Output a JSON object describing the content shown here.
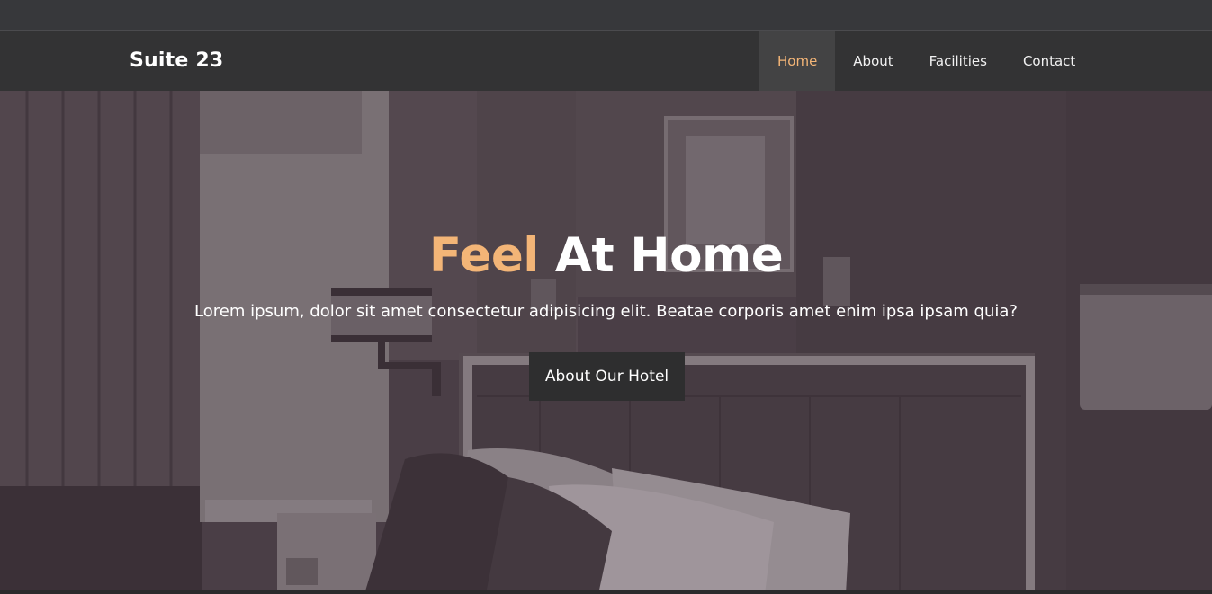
{
  "brand": {
    "name": "Suite 23"
  },
  "nav": {
    "items": [
      {
        "label": "Home",
        "active": true
      },
      {
        "label": "About",
        "active": false
      },
      {
        "label": "Facilities",
        "active": false
      },
      {
        "label": "Contact",
        "active": false
      }
    ]
  },
  "hero": {
    "headline_accent": "Feel",
    "headline_rest": "At Home",
    "subtext": "Lorem ipsum, dolor sit amet consectetur adipisicing elit. Beatae corporis amet enim ipsa ipsam quia?",
    "cta_label": "About Our Hotel"
  },
  "colors": {
    "accent": "#f3b577",
    "navbar": "#333334",
    "button": "#2e2e2f",
    "hero_tint": "#4d4248"
  }
}
